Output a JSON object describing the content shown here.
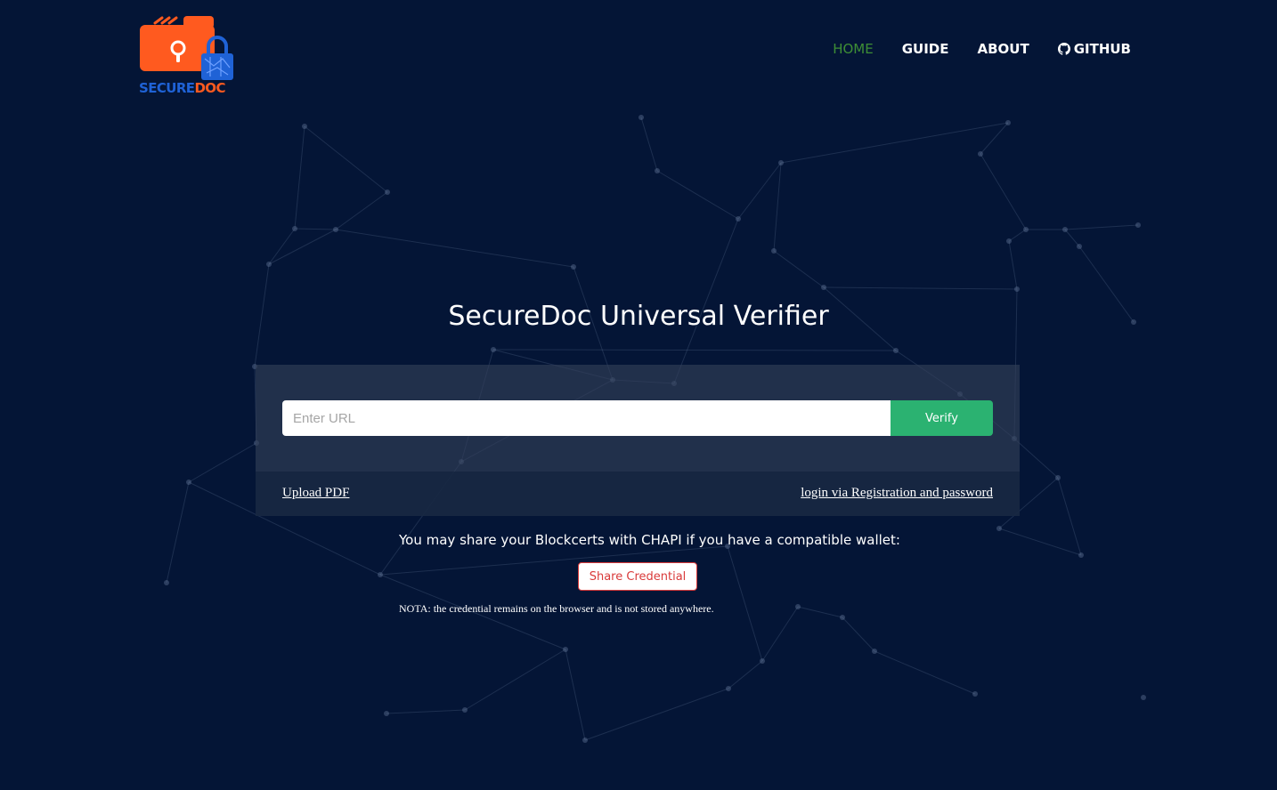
{
  "brand": {
    "logo_text_part1": "SECURE",
    "logo_text_part2": "DOC",
    "primary_color": "#ff5a1f",
    "secondary_color": "#1f62d6"
  },
  "nav": {
    "items": [
      {
        "label": "HOME",
        "active": true
      },
      {
        "label": "GUIDE",
        "active": false
      },
      {
        "label": "ABOUT",
        "active": false
      },
      {
        "label": "GITHUB",
        "active": false,
        "icon": "github-icon"
      }
    ],
    "active_color": "#3e8e35"
  },
  "main": {
    "title": "SecureDoc Universal Verifier",
    "url_input": {
      "placeholder": "Enter URL",
      "value": ""
    },
    "verify_label": "Verify",
    "verify_color": "#2bb271",
    "upload_link": "Upload PDF",
    "login_link": "login via Registration and password"
  },
  "share": {
    "text": "You may share your Blockcerts with CHAPI if you have a compatible wallet:",
    "button_label": "Share Credential",
    "button_color": "#d93a3a",
    "note": "NOTA: the credential remains on the browser and is not stored anywhere."
  },
  "colors": {
    "background": "#041536"
  }
}
